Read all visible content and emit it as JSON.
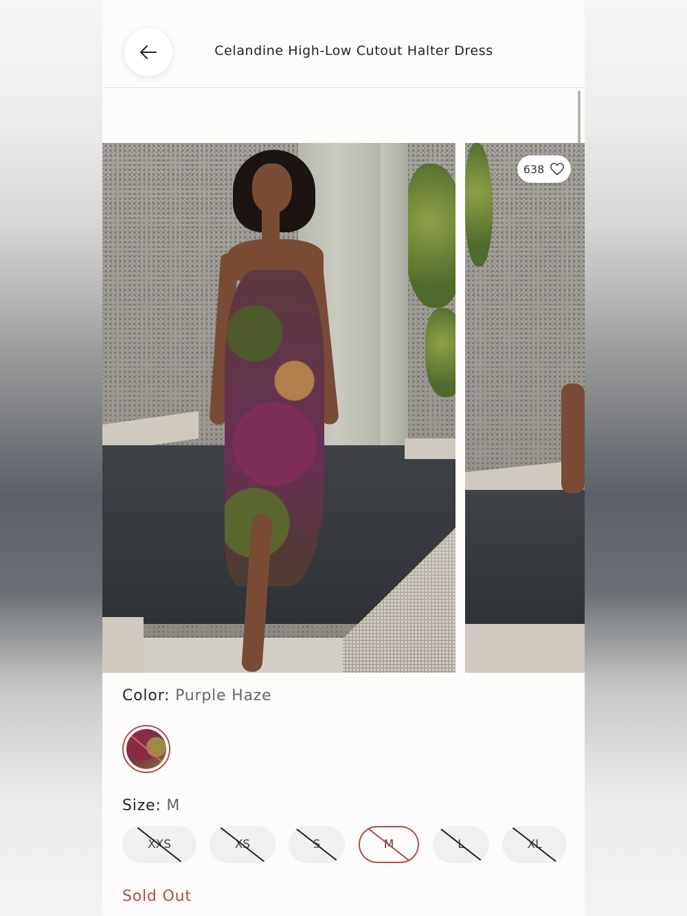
{
  "header": {
    "title": "Celandine High-Low Cutout Halter Dress",
    "back_icon": "arrow-left-icon"
  },
  "gallery": {
    "likes_count": "638",
    "like_icon": "heart-outline-icon"
  },
  "color": {
    "label": "Color:",
    "value": "Purple Haze"
  },
  "size": {
    "label": "Size:",
    "value": "M",
    "options": [
      {
        "label": "XXS",
        "available": false,
        "selected": false
      },
      {
        "label": "XS",
        "available": false,
        "selected": false
      },
      {
        "label": "S",
        "available": false,
        "selected": false
      },
      {
        "label": "M",
        "available": false,
        "selected": true
      },
      {
        "label": "L",
        "available": false,
        "selected": false
      },
      {
        "label": "XL",
        "available": false,
        "selected": false
      }
    ]
  },
  "availability": {
    "status": "Sold Out"
  },
  "colors": {
    "accent": "#b04a4a"
  }
}
